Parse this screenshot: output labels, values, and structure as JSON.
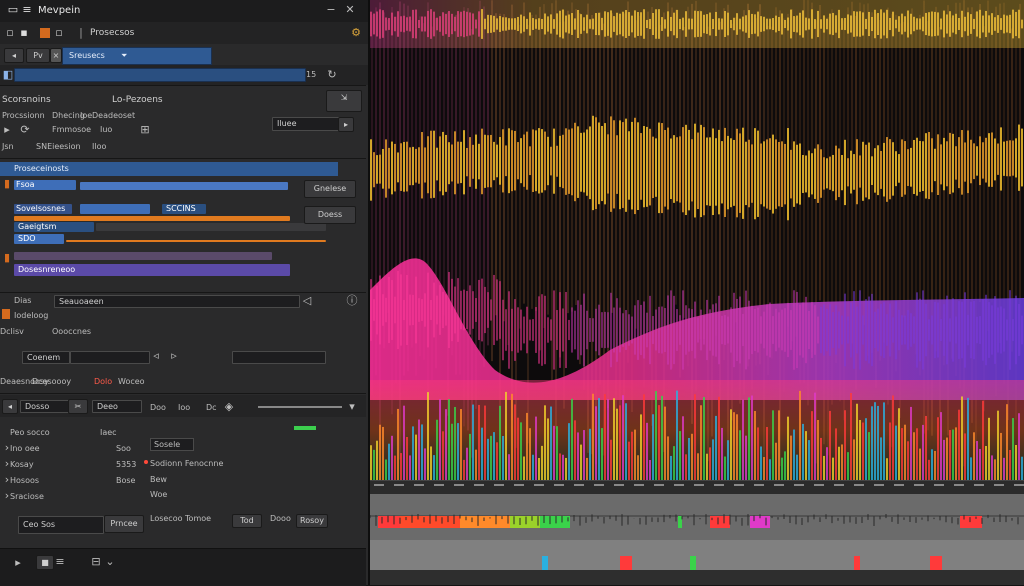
{
  "app": {
    "title": "Mevpein",
    "close_glyph": "✕"
  },
  "toolbar": {
    "project_label": "Prosecsos",
    "tab_label": "Pv",
    "combo_value": "Sreusecs",
    "combo_arrow": "⏷",
    "search_value": "",
    "search_num": "15"
  },
  "section_a": {
    "label_left": "Scorsnoins",
    "label_mid": "Lo-Pezoens",
    "row2_left": "Procssionn",
    "row2_mid": "Dhecing",
    "row2_val": "Ioe",
    "row2_right": "Deadeoset",
    "row2_field": "Iluee",
    "sub_left": "Fmmosoe",
    "sub_mid": "Iuo",
    "header_left": "Jsn",
    "header_mid": "SNEieesion",
    "header_right": "Iloo"
  },
  "tracks": {
    "header": "Proseceinosts",
    "items": [
      {
        "label": "Fsoa",
        "tag": "SCCINS",
        "color": "#3e6eb8"
      },
      {
        "label": "Sovelsosnes",
        "tag": "SDO",
        "color": "#d88a2a"
      },
      {
        "label": "Gaeigtsm",
        "tag": "",
        "color": "#34518a"
      },
      {
        "label": "Dosesnreneoo",
        "tag": "",
        "color": "#5b4aa8"
      }
    ],
    "side_btn_top": "Gnelese",
    "side_btn_bottom": "Doess"
  },
  "section_b": {
    "row1_left": "Dias",
    "row1_field": "Seauoaeen",
    "row2_left": "Iodeloog",
    "row2_mid": "Dclisv",
    "row2_right": "Oooccnes",
    "row3_field": "Coenem",
    "row4_left": "Deaesnoosy",
    "row4_badge": "Dolo",
    "row4_right": "Woceo"
  },
  "transport": {
    "field1": "Dosso",
    "field2": "Deeo",
    "lbl1": "Doo",
    "lbl2": "Ioo",
    "lbl3": "Dc"
  },
  "properties": {
    "rows": [
      {
        "name": "Peo socco",
        "value": "Iaec",
        "extra": "Sosele"
      },
      {
        "name": "Ino oee",
        "value": "Soo",
        "extra": ""
      },
      {
        "name": "Kosay",
        "value": "5353",
        "extra": "Sodionn Fenocnne"
      },
      {
        "name": "Hosoos",
        "value": "Bose",
        "extra": "Bew"
      },
      {
        "name": "Sraciose",
        "value": "",
        "extra": "Woe"
      }
    ]
  },
  "footer": {
    "field": "Ceo Sos",
    "btn1": "Prncee",
    "lbl1": "Losecoo Tomoe",
    "field2": "Tod",
    "lbl2": "Dooo",
    "field3": "Rosoy"
  },
  "colors": {
    "accent_blue": "#3e6eb8",
    "accent_orange": "#e07a1f",
    "panel_bg": "#2a2a2b"
  },
  "icons": [
    "folder-icon",
    "save-icon",
    "record-icon",
    "settings-icon",
    "play-icon",
    "loop-icon",
    "trash-icon",
    "volume-icon"
  ]
}
